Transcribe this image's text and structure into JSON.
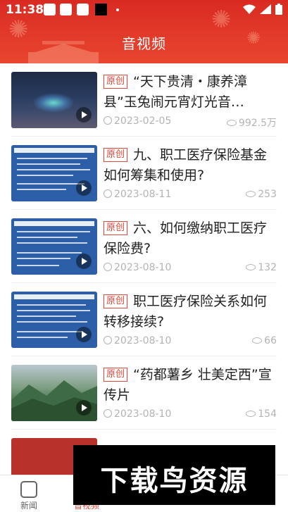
{
  "status_bar": {
    "time": "11:38"
  },
  "header": {
    "title": "音视频"
  },
  "items": [
    {
      "badge": "原创",
      "title": "“天下贵清・康养漳县”玉兔闹元宵灯光音…",
      "date": "2023-02-05",
      "views": "992.5万",
      "thumb": "night-lantern-festival"
    },
    {
      "badge": "原创",
      "title": "九、职工医疗保险基金如何筹集和使用?",
      "date": "2023-08-11",
      "views": "253",
      "thumb": "document-slide"
    },
    {
      "badge": "原创",
      "title": "六、如何缴纳职工医疗保险费?",
      "date": "2023-08-10",
      "views": "132",
      "thumb": "document-slide"
    },
    {
      "badge": "原创",
      "title": "职工医疗保险关系如何转移接续?",
      "date": "2023-08-10",
      "views": "66",
      "thumb": "document-slide"
    },
    {
      "badge": "原创",
      "title": "“药都薯乡 壮美定西”宣传片",
      "date": "2023-08-10",
      "views": "154",
      "thumb": "green-hills"
    }
  ],
  "bottom_nav": [
    {
      "label": "新闻",
      "icon": "news-icon",
      "active": false
    },
    {
      "label": "音视频",
      "icon": "video-icon",
      "active": true
    },
    {
      "label": "",
      "icon": "culture-icon",
      "active": false
    },
    {
      "label": "",
      "icon": "life-icon",
      "active": false
    },
    {
      "label": "",
      "icon": "mine-icon",
      "active": false
    }
  ],
  "watermark": {
    "text": "下载鸟资源"
  },
  "colors": {
    "brand_red": "#e0463b",
    "header_red": "#d92a22"
  }
}
